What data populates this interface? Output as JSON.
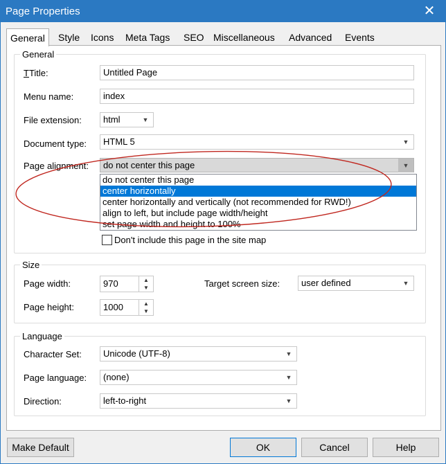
{
  "window": {
    "title": "Page Properties"
  },
  "tabs": [
    "General",
    "Style",
    "Icons",
    "Meta Tags",
    "SEO",
    "Miscellaneous",
    "Advanced",
    "Events"
  ],
  "general": {
    "legend": "General",
    "title_label": "Title:",
    "title_value": "Untitled Page",
    "menu_name_label": "Menu name:",
    "menu_name_value": "index",
    "file_extension_label": "File extension:",
    "file_extension_value": "html",
    "document_type_label": "Document type:",
    "document_type_value": "HTML 5",
    "page_alignment_label": "Page alignment:",
    "page_alignment_value": "do not center this page",
    "page_alignment_options": [
      "do not center this page",
      "center horizontally",
      "center horizontally and vertically (not recommended for RWD!)",
      "align to left, but include page width/height",
      "set page width and height to 100%"
    ],
    "page_alignment_highlighted": 1,
    "sitemap_checkbox_label": "Don't include this page in the site map",
    "sitemap_checked": false
  },
  "size": {
    "legend": "Size",
    "page_width_label": "Page width:",
    "page_width_value": "970",
    "page_height_label": "Page height:",
    "page_height_value": "1000",
    "target_screen_label": "Target screen size:",
    "target_screen_value": "user defined"
  },
  "language": {
    "legend": "Language",
    "charset_label": "Character Set:",
    "charset_value": "Unicode (UTF-8)",
    "page_language_label": "Page language:",
    "page_language_value": "(none)",
    "direction_label": "Direction:",
    "direction_value": "left-to-right"
  },
  "buttons": {
    "make_default": "Make Default",
    "ok": "OK",
    "cancel": "Cancel",
    "help": "Help"
  },
  "colors": {
    "titlebar": "#2b79c2",
    "highlight": "#0078d7",
    "annotation": "#c0271f"
  },
  "icons": {
    "close": "close-icon",
    "dropdown": "chevron-down-icon",
    "spin_up": "spin-up-icon",
    "spin_down": "spin-down-icon"
  }
}
